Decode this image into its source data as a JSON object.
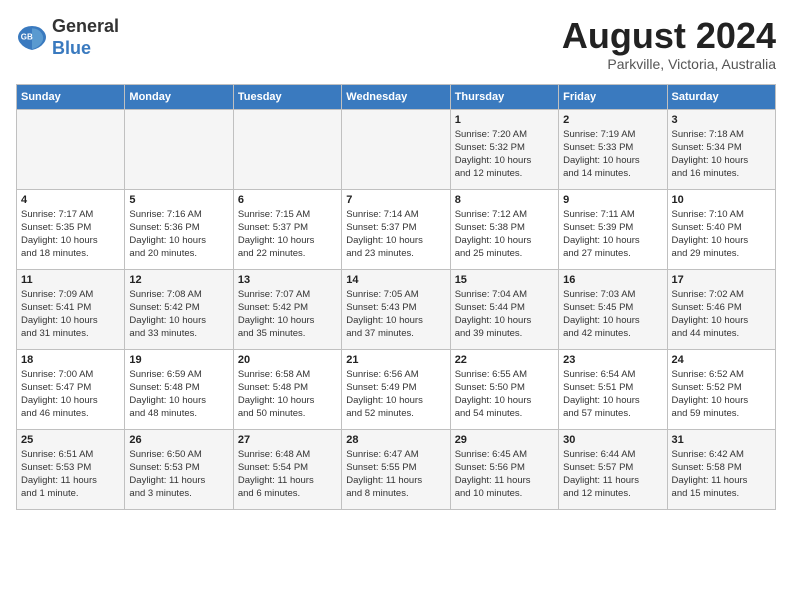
{
  "header": {
    "logo_line1": "General",
    "logo_line2": "Blue",
    "month_year": "August 2024",
    "location": "Parkville, Victoria, Australia"
  },
  "days_of_week": [
    "Sunday",
    "Monday",
    "Tuesday",
    "Wednesday",
    "Thursday",
    "Friday",
    "Saturday"
  ],
  "weeks": [
    [
      {
        "day": "",
        "info": ""
      },
      {
        "day": "",
        "info": ""
      },
      {
        "day": "",
        "info": ""
      },
      {
        "day": "",
        "info": ""
      },
      {
        "day": "1",
        "info": "Sunrise: 7:20 AM\nSunset: 5:32 PM\nDaylight: 10 hours\nand 12 minutes."
      },
      {
        "day": "2",
        "info": "Sunrise: 7:19 AM\nSunset: 5:33 PM\nDaylight: 10 hours\nand 14 minutes."
      },
      {
        "day": "3",
        "info": "Sunrise: 7:18 AM\nSunset: 5:34 PM\nDaylight: 10 hours\nand 16 minutes."
      }
    ],
    [
      {
        "day": "4",
        "info": "Sunrise: 7:17 AM\nSunset: 5:35 PM\nDaylight: 10 hours\nand 18 minutes."
      },
      {
        "day": "5",
        "info": "Sunrise: 7:16 AM\nSunset: 5:36 PM\nDaylight: 10 hours\nand 20 minutes."
      },
      {
        "day": "6",
        "info": "Sunrise: 7:15 AM\nSunset: 5:37 PM\nDaylight: 10 hours\nand 22 minutes."
      },
      {
        "day": "7",
        "info": "Sunrise: 7:14 AM\nSunset: 5:37 PM\nDaylight: 10 hours\nand 23 minutes."
      },
      {
        "day": "8",
        "info": "Sunrise: 7:12 AM\nSunset: 5:38 PM\nDaylight: 10 hours\nand 25 minutes."
      },
      {
        "day": "9",
        "info": "Sunrise: 7:11 AM\nSunset: 5:39 PM\nDaylight: 10 hours\nand 27 minutes."
      },
      {
        "day": "10",
        "info": "Sunrise: 7:10 AM\nSunset: 5:40 PM\nDaylight: 10 hours\nand 29 minutes."
      }
    ],
    [
      {
        "day": "11",
        "info": "Sunrise: 7:09 AM\nSunset: 5:41 PM\nDaylight: 10 hours\nand 31 minutes."
      },
      {
        "day": "12",
        "info": "Sunrise: 7:08 AM\nSunset: 5:42 PM\nDaylight: 10 hours\nand 33 minutes."
      },
      {
        "day": "13",
        "info": "Sunrise: 7:07 AM\nSunset: 5:42 PM\nDaylight: 10 hours\nand 35 minutes."
      },
      {
        "day": "14",
        "info": "Sunrise: 7:05 AM\nSunset: 5:43 PM\nDaylight: 10 hours\nand 37 minutes."
      },
      {
        "day": "15",
        "info": "Sunrise: 7:04 AM\nSunset: 5:44 PM\nDaylight: 10 hours\nand 39 minutes."
      },
      {
        "day": "16",
        "info": "Sunrise: 7:03 AM\nSunset: 5:45 PM\nDaylight: 10 hours\nand 42 minutes."
      },
      {
        "day": "17",
        "info": "Sunrise: 7:02 AM\nSunset: 5:46 PM\nDaylight: 10 hours\nand 44 minutes."
      }
    ],
    [
      {
        "day": "18",
        "info": "Sunrise: 7:00 AM\nSunset: 5:47 PM\nDaylight: 10 hours\nand 46 minutes."
      },
      {
        "day": "19",
        "info": "Sunrise: 6:59 AM\nSunset: 5:48 PM\nDaylight: 10 hours\nand 48 minutes."
      },
      {
        "day": "20",
        "info": "Sunrise: 6:58 AM\nSunset: 5:48 PM\nDaylight: 10 hours\nand 50 minutes."
      },
      {
        "day": "21",
        "info": "Sunrise: 6:56 AM\nSunset: 5:49 PM\nDaylight: 10 hours\nand 52 minutes."
      },
      {
        "day": "22",
        "info": "Sunrise: 6:55 AM\nSunset: 5:50 PM\nDaylight: 10 hours\nand 54 minutes."
      },
      {
        "day": "23",
        "info": "Sunrise: 6:54 AM\nSunset: 5:51 PM\nDaylight: 10 hours\nand 57 minutes."
      },
      {
        "day": "24",
        "info": "Sunrise: 6:52 AM\nSunset: 5:52 PM\nDaylight: 10 hours\nand 59 minutes."
      }
    ],
    [
      {
        "day": "25",
        "info": "Sunrise: 6:51 AM\nSunset: 5:53 PM\nDaylight: 11 hours\nand 1 minute."
      },
      {
        "day": "26",
        "info": "Sunrise: 6:50 AM\nSunset: 5:53 PM\nDaylight: 11 hours\nand 3 minutes."
      },
      {
        "day": "27",
        "info": "Sunrise: 6:48 AM\nSunset: 5:54 PM\nDaylight: 11 hours\nand 6 minutes."
      },
      {
        "day": "28",
        "info": "Sunrise: 6:47 AM\nSunset: 5:55 PM\nDaylight: 11 hours\nand 8 minutes."
      },
      {
        "day": "29",
        "info": "Sunrise: 6:45 AM\nSunset: 5:56 PM\nDaylight: 11 hours\nand 10 minutes."
      },
      {
        "day": "30",
        "info": "Sunrise: 6:44 AM\nSunset: 5:57 PM\nDaylight: 11 hours\nand 12 minutes."
      },
      {
        "day": "31",
        "info": "Sunrise: 6:42 AM\nSunset: 5:58 PM\nDaylight: 11 hours\nand 15 minutes."
      }
    ]
  ]
}
